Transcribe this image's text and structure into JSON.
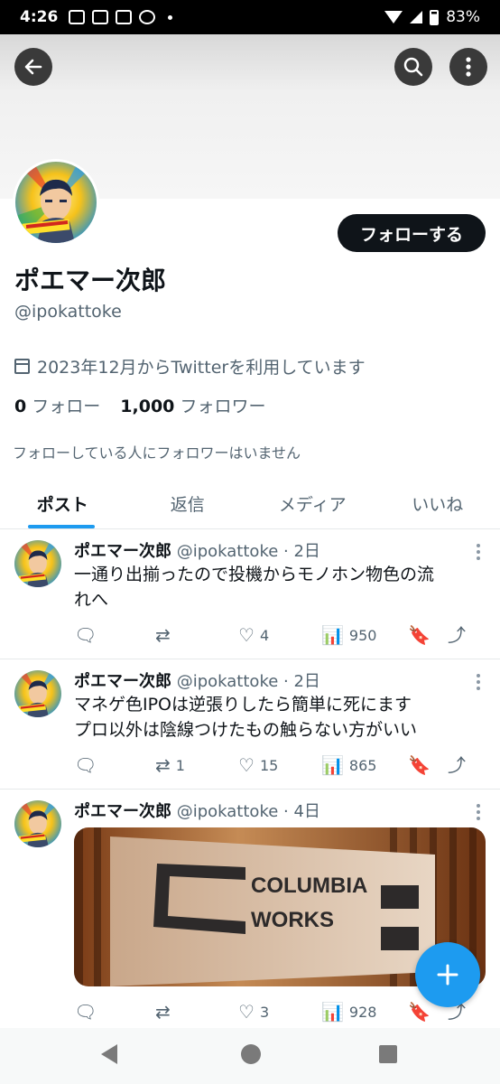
{
  "status_bar": {
    "time": "4:26",
    "battery": "83%"
  },
  "header": {
    "back_icon": "arrow-left-icon",
    "search_icon": "search-icon",
    "more_icon": "more-vertical-icon"
  },
  "profile": {
    "display_name": "ポエマー次郎",
    "handle": "@ipokattoke",
    "follow_button": "フォローする",
    "joined": "2023年12月からTwitterを利用しています",
    "following_count": "0",
    "following_label": "フォロー",
    "followers_count": "1,000",
    "followers_label": "フォロワー",
    "mutual_note": "フォローしている人にフォロワーはいません"
  },
  "tabs": [
    {
      "label": "ポスト",
      "active": true
    },
    {
      "label": "返信",
      "active": false
    },
    {
      "label": "メディア",
      "active": false
    },
    {
      "label": "いいね",
      "active": false
    }
  ],
  "tweets": [
    {
      "name": "ポエマー次郎",
      "meta": "@ipokattoke · 2日",
      "lines": [
        "一通り出揃ったので投機からモノホン物色の流",
        "れへ"
      ],
      "replies": "",
      "retweets": "",
      "likes": "4",
      "views": "950"
    },
    {
      "name": "ポエマー次郎",
      "meta": "@ipokattoke · 2日",
      "lines": [
        "マネゲ色IPOは逆張りしたら簡単に死にます",
        "プロ以外は陰線つけたもの触らない方がいい"
      ],
      "replies": "",
      "retweets": "1",
      "likes": "15",
      "views": "865"
    },
    {
      "name": "ポエマー次郎",
      "meta": "@ipokattoke · 4日",
      "media_text": [
        "COLUMBIA",
        "WORKS"
      ],
      "replies": "",
      "retweets": "",
      "likes": "3",
      "views": "928"
    }
  ],
  "colors": {
    "accent": "#1d9bf0",
    "text": "#0f1419",
    "muted": "#536471"
  }
}
